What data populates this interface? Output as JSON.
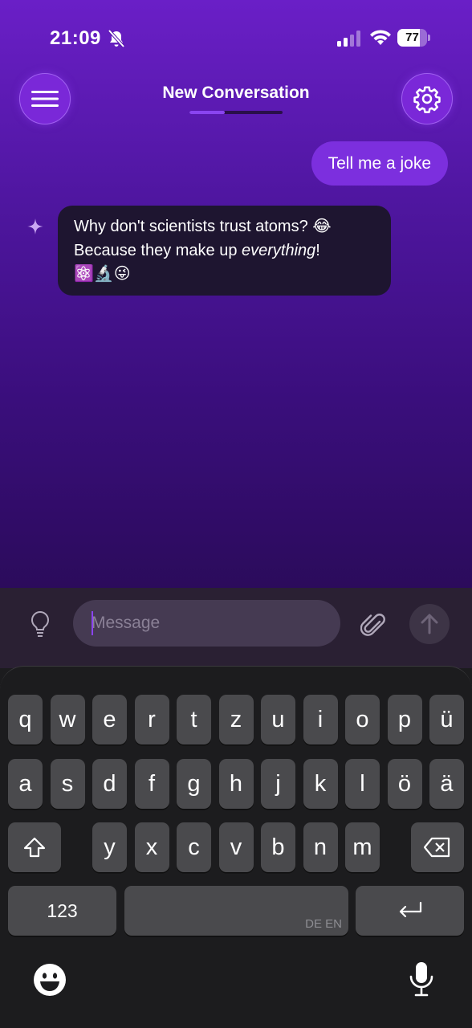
{
  "status_bar": {
    "time": "21:09",
    "battery": "77",
    "battery_level": 0.77,
    "signal_bars_active": 2
  },
  "header": {
    "title": "New Conversation",
    "progress": 0.38,
    "menu_icon": "hamburger-menu-icon",
    "settings_icon": "gear-icon"
  },
  "messages": {
    "user": {
      "text": "Tell me a joke"
    },
    "assistant": {
      "line1": "Why don't scientists trust atoms? 😂",
      "line2_start": "Because they make up ",
      "line2_em": "everything",
      "line2_end": "!",
      "line3": "⚛️🔬😜"
    }
  },
  "composer": {
    "placeholder": "Message",
    "value": "",
    "left_icon": "lightbulb-icon",
    "attach_icon": "paperclip-icon",
    "send_icon": "arrow-up-icon"
  },
  "keyboard": {
    "row1": [
      "q",
      "w",
      "e",
      "r",
      "t",
      "z",
      "u",
      "i",
      "o",
      "p",
      "ü"
    ],
    "row2": [
      "a",
      "s",
      "d",
      "f",
      "g",
      "h",
      "j",
      "k",
      "l",
      "ö",
      "ä"
    ],
    "row3": [
      "y",
      "x",
      "c",
      "v",
      "b",
      "n",
      "m"
    ],
    "numbers_label": "123",
    "space_hint": "DE EN",
    "shift_icon": "shift-icon",
    "delete_icon": "backspace-icon",
    "return_icon": "return-icon",
    "emoji_icon": "emoji-icon",
    "mic_icon": "microphone-icon"
  },
  "colors": {
    "accent": "#7c2fde",
    "background_top": "#6a1fc7",
    "background_bottom": "#250a4e",
    "bot_bubble": "#1e1530",
    "keyboard": "#1c1c1e",
    "key": "#4a4a4d"
  }
}
